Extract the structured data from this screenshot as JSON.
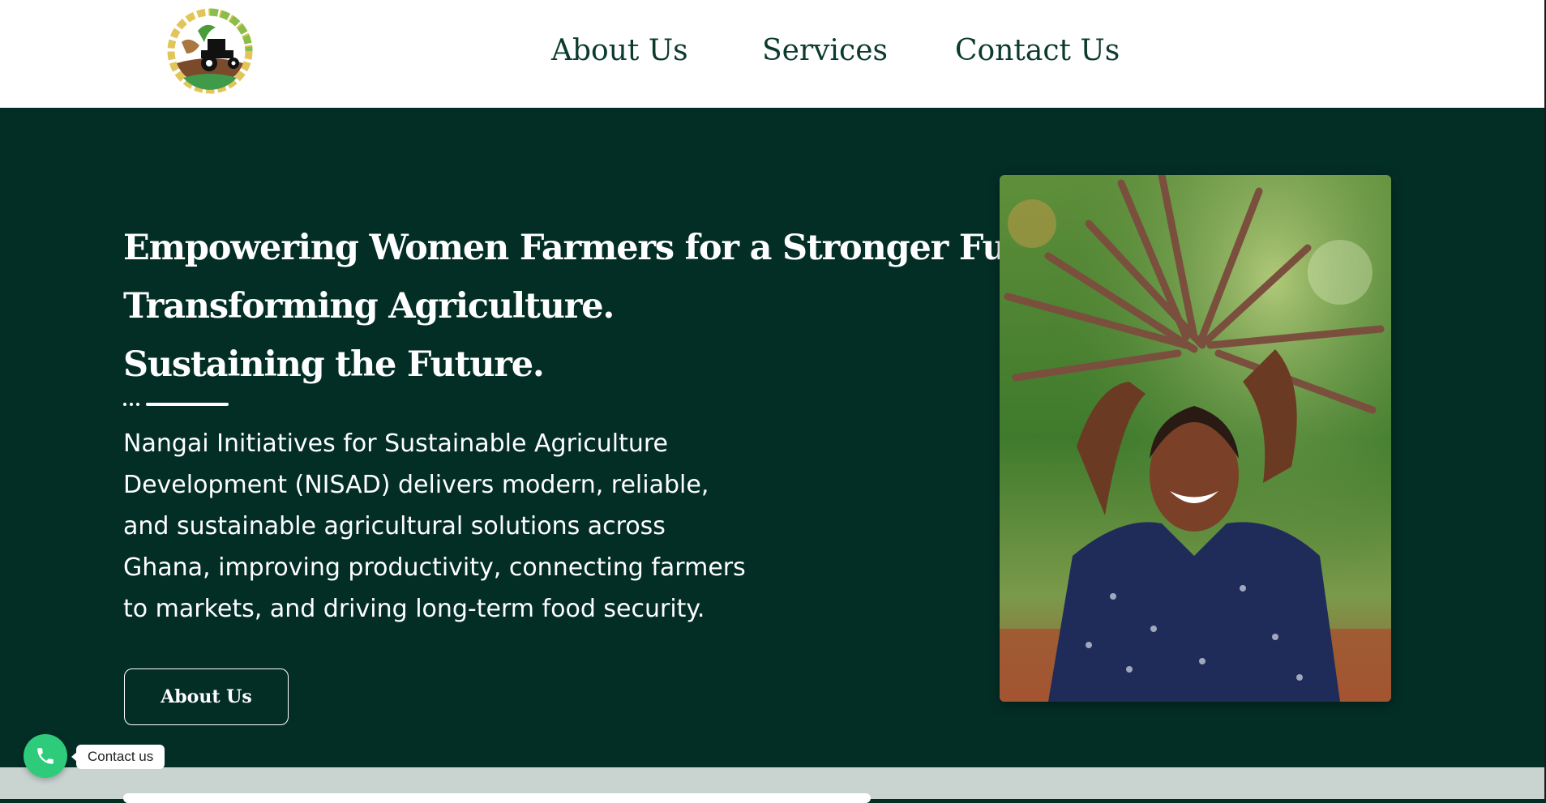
{
  "nav": {
    "about_label": "About Us",
    "services_label": "Services",
    "contact_label": "Contact Us"
  },
  "hero": {
    "title_lines": [
      "Empowering Women Farmers for a Stronger Future.",
      "Transforming Agriculture.",
      "Sustaining the Future."
    ],
    "description": "Nangai Initiatives for Sustainable Agriculture Development (NISAD) delivers modern, reliable, and sustainable agricultural solutions across Ghana, improving productivity, connecting farmers to markets, and driving long-term food security.",
    "cta_label": "About Us"
  },
  "floating_contact": {
    "label": "Contact us",
    "icon": "phone-icon"
  },
  "colors": {
    "hero_background": "#032e26",
    "header_background": "#ffffff",
    "nav_text": "#0b3a2e",
    "fab_green": "#2ecc7a",
    "band": "#c9d3d0"
  },
  "icons": {
    "logo": "tractor-logo",
    "hero_image": "woman-farmer-carrying-cassava-stems-photo"
  }
}
